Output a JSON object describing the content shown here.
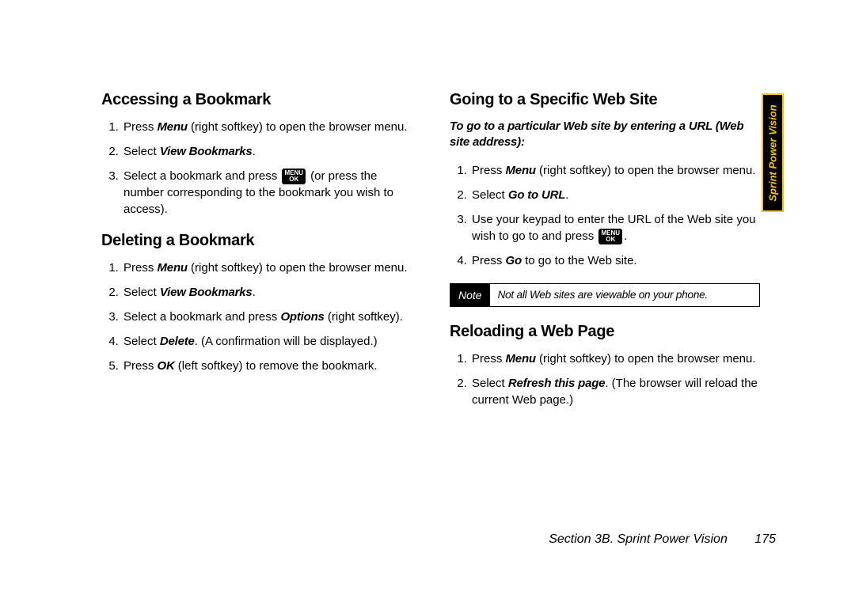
{
  "sideTab": "Sprint Power Vision",
  "footer": {
    "section": "Section 3B. Sprint Power Vision",
    "page": "175"
  },
  "noteLabel": "Note",
  "menuOk": {
    "line1": "MENU",
    "line2": "OK"
  },
  "left": {
    "h1": "Accessing a Bookmark",
    "s1": {
      "i1a": "Press ",
      "i1b": "Menu",
      "i1c": " (right softkey) to open the browser menu.",
      "i2a": "Select ",
      "i2b": "View Bookmarks",
      "i2c": ".",
      "i3a": "Select a bookmark and press ",
      "i3b": " (or press the number corresponding to the bookmark you wish to access)."
    },
    "h2": "Deleting a Bookmark",
    "s2": {
      "i1a": "Press ",
      "i1b": "Menu",
      "i1c": " (right softkey) to open the browser menu.",
      "i2a": "Select ",
      "i2b": "View Bookmarks",
      "i2c": ".",
      "i3a": "Select a bookmark and press ",
      "i3b": "Options",
      "i3c": " (right softkey).",
      "i4a": "Select ",
      "i4b": "Delete",
      "i4c": ". (A confirmation will be displayed.)",
      "i5a": "Press ",
      "i5b": "OK",
      "i5c": " (left softkey) to remove the bookmark."
    }
  },
  "right": {
    "h1": "Going to a Specific Web Site",
    "lead": "To go to a particular Web site by entering a URL (Web site address):",
    "s1": {
      "i1a": "Press ",
      "i1b": "Menu",
      "i1c": " (right softkey) to open the browser menu.",
      "i2a": "Select ",
      "i2b": "Go to URL",
      "i2c": ".",
      "i3a": "Use your keypad to enter the URL of the Web site you wish to go to and press ",
      "i3b": ".",
      "i4a": "Press ",
      "i4b": "Go",
      "i4c": " to go to the Web site."
    },
    "note": "Not all Web sites are viewable on your phone.",
    "h2": "Reloading a Web Page",
    "s2": {
      "i1a": "Press ",
      "i1b": "Menu",
      "i1c": " (right softkey) to open the browser menu.",
      "i2a": "Select ",
      "i2b": "Refresh this page",
      "i2c": ". (The browser will reload the current Web page.)"
    }
  }
}
